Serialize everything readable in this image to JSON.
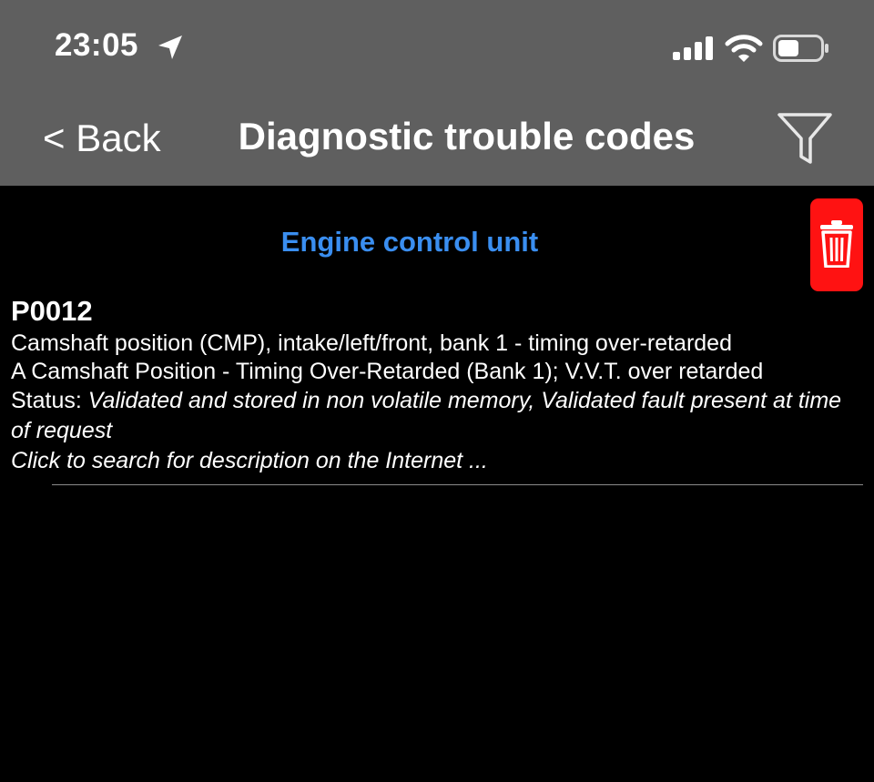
{
  "status_bar": {
    "time": "23:05",
    "icons": [
      "location-arrow-icon",
      "cellular-signal-icon",
      "wifi-icon",
      "battery-icon"
    ]
  },
  "nav": {
    "back_label": "< Back",
    "title": "Diagnostic trouble codes",
    "filter_icon": "filter-funnel-icon"
  },
  "section": {
    "title": "Engine control unit",
    "delete_icon": "trash-icon"
  },
  "dtc": {
    "code": "P0012",
    "line1": "Camshaft position (CMP), intake/left/front, bank 1 - timing over-retarded",
    "line2": "A Camshaft Position - Timing Over-Retarded (Bank 1); V.V.T. over retarded",
    "status_label": "Status: ",
    "status_value": "Validated and stored in non volatile memory, Validated fault present at time of request",
    "search_link": "Click to search for description on the Internet ..."
  },
  "colors": {
    "bar_background": "#5f5f5f",
    "page_background": "#000000",
    "accent_blue": "#3a8ef0",
    "delete_red": "#ff1212"
  }
}
